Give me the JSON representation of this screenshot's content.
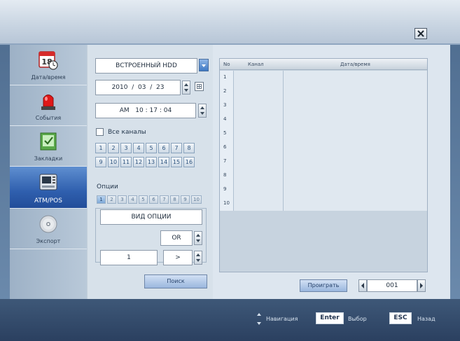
{
  "sidebar": {
    "items": [
      {
        "label": "Дата/время",
        "icon": "calendar-clock-icon"
      },
      {
        "label": "События",
        "icon": "alarm-siren-icon"
      },
      {
        "label": "Закладки",
        "icon": "bookmark-check-icon"
      },
      {
        "label": "ATM/POS",
        "icon": "atm-terminal-icon",
        "active": true
      },
      {
        "label": "Экспорт",
        "icon": "cd-disc-icon"
      }
    ]
  },
  "search": {
    "source_value": "ВСТРОЕННЫЙ HDD",
    "date_year": "2010",
    "date_month": "03",
    "date_day": "23",
    "time_ampm": "AM",
    "time_hour": "10",
    "time_min": "17",
    "time_sec": "04",
    "all_channels_label": "Все каналы",
    "channels": [
      "1",
      "2",
      "3",
      "4",
      "5",
      "6",
      "7",
      "8",
      "9",
      "10",
      "11",
      "12",
      "13",
      "14",
      "15",
      "16"
    ],
    "options_label": "Опции",
    "options": [
      "1",
      "2",
      "3",
      "4",
      "5",
      "6",
      "7",
      "8",
      "9",
      "10"
    ],
    "option_type_label": "ВИД ОПЦИИ",
    "operator_value": "OR",
    "condition_value": "1",
    "comparator_value": ">",
    "search_button": "Поиск",
    "separator": "/",
    "time_sep": ":"
  },
  "results": {
    "headers": {
      "no": "No",
      "channel": "Канал",
      "datetime": "Дата/время"
    },
    "rows": [
      "1",
      "2",
      "3",
      "4",
      "5",
      "6",
      "7",
      "8",
      "9",
      "10"
    ]
  },
  "playback": {
    "play_button": "Проиграть",
    "page_value": "001"
  },
  "footer": {
    "nav_label": "Навигация",
    "enter_key": "Enter",
    "enter_label": "Выбор",
    "esc_key": "ESC",
    "esc_label": "Назад"
  },
  "colors": {
    "accent": "#2f5fae",
    "panel": "#dde6ef"
  }
}
